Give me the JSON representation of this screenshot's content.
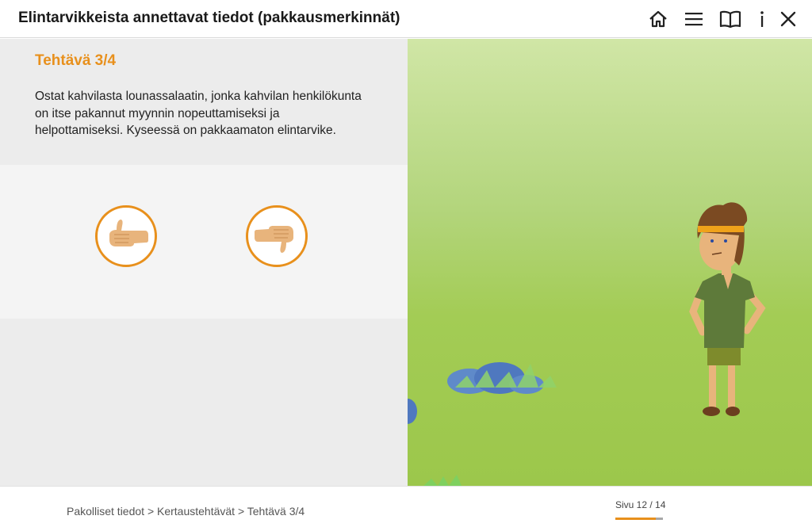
{
  "header": {
    "title": "Elintarvikkeista annettavat tiedot (pakkausmerkinnät)",
    "icons": [
      "home-icon",
      "menu-icon",
      "book-icon",
      "info-icon",
      "close-icon"
    ]
  },
  "task": {
    "title": "Tehtävä 3/4",
    "text": "Ostat kahvilasta lounassalaatin, jonka kahvilan henkilökunta on itse pakannut myynnin nopeuttamiseksi ja helpottamiseksi. Kyseessä on pakkaamaton elintarvike."
  },
  "answers": {
    "true_icon": "thumbs-up-icon",
    "false_icon": "thumbs-down-icon"
  },
  "footer": {
    "breadcrumb": "Pakolliset tiedot > Kertaustehtävät > Tehtävä 3/4",
    "page_label": "Sivu 12 / 14",
    "progress": 0.857
  },
  "colors": {
    "accent": "#e8901c",
    "scene_top": "#d0e6a6",
    "scene_bottom": "#9cc74b"
  }
}
